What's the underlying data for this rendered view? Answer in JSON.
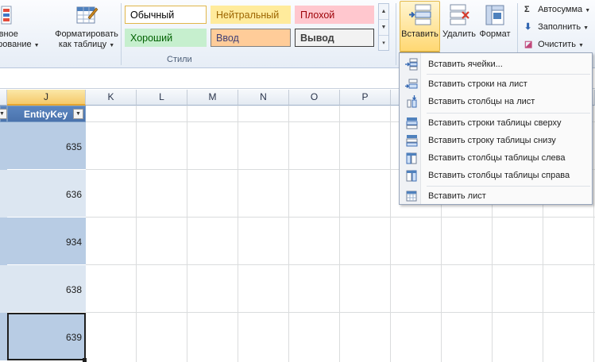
{
  "ribbon": {
    "conditional_format": {
      "label_line1": "ловное",
      "label_line2": "тирование"
    },
    "format_as_table": {
      "label_line1": "Форматировать",
      "label_line2": "как таблицу"
    },
    "styles": {
      "group_label": "Стили",
      "cells": [
        {
          "label": "Обычный",
          "bg": "#ffffff",
          "color": "#000000",
          "border": "#e0b64a"
        },
        {
          "label": "Нейтральный",
          "bg": "#ffeb9c",
          "color": "#9c6500",
          "border": "#ffeb9c"
        },
        {
          "label": "Плохой",
          "bg": "#ffc7ce",
          "color": "#9c0006",
          "border": "#ffc7ce"
        },
        {
          "label": "Хороший",
          "bg": "#c6efce",
          "color": "#006100",
          "border": "#c6efce"
        },
        {
          "label": "Ввод",
          "bg": "#ffcc99",
          "color": "#3f3f76",
          "border": "#7f7f7f"
        },
        {
          "label": "Вывод",
          "bg": "#f2f2f2",
          "color": "#3f3f3f",
          "border": "#3f3f3f"
        }
      ]
    },
    "cells_group": {
      "insert_label": "Вставить",
      "delete_label": "Удалить",
      "format_label": "Формат"
    },
    "editing": {
      "autosum_label": "Автосумма",
      "fill_label": "Заполнить",
      "clear_label": "Очистить"
    }
  },
  "sheet": {
    "columns": [
      "J",
      "K",
      "L",
      "M",
      "N",
      "O",
      "P"
    ],
    "selected_column": "J",
    "table_header": "EntityKey",
    "values": [
      "635",
      "636",
      "934",
      "638",
      "639"
    ],
    "colors": {
      "band_dark": "#b8cce4",
      "band_light": "#dce6f1",
      "header_blue": "#4f81bd"
    }
  },
  "insert_menu": {
    "items": [
      {
        "label": "Вставить ячейки...",
        "icon": "insert-cells-icon"
      },
      {
        "label": "Вставить строки на лист",
        "icon": "insert-rows-icon"
      },
      {
        "label": "Вставить столбцы на лист",
        "icon": "insert-columns-icon"
      },
      {
        "label": "Вставить строки таблицы сверху",
        "icon": "insert-table-rows-above-icon"
      },
      {
        "label": "Вставить строку таблицы снизу",
        "icon": "insert-table-row-below-icon"
      },
      {
        "label": "Вставить столбцы таблицы слева",
        "icon": "insert-table-columns-left-icon"
      },
      {
        "label": "Вставить столбцы таблицы справа",
        "icon": "insert-table-columns-right-icon"
      },
      {
        "label": "Вставить лист",
        "icon": "insert-sheet-icon"
      }
    ]
  }
}
